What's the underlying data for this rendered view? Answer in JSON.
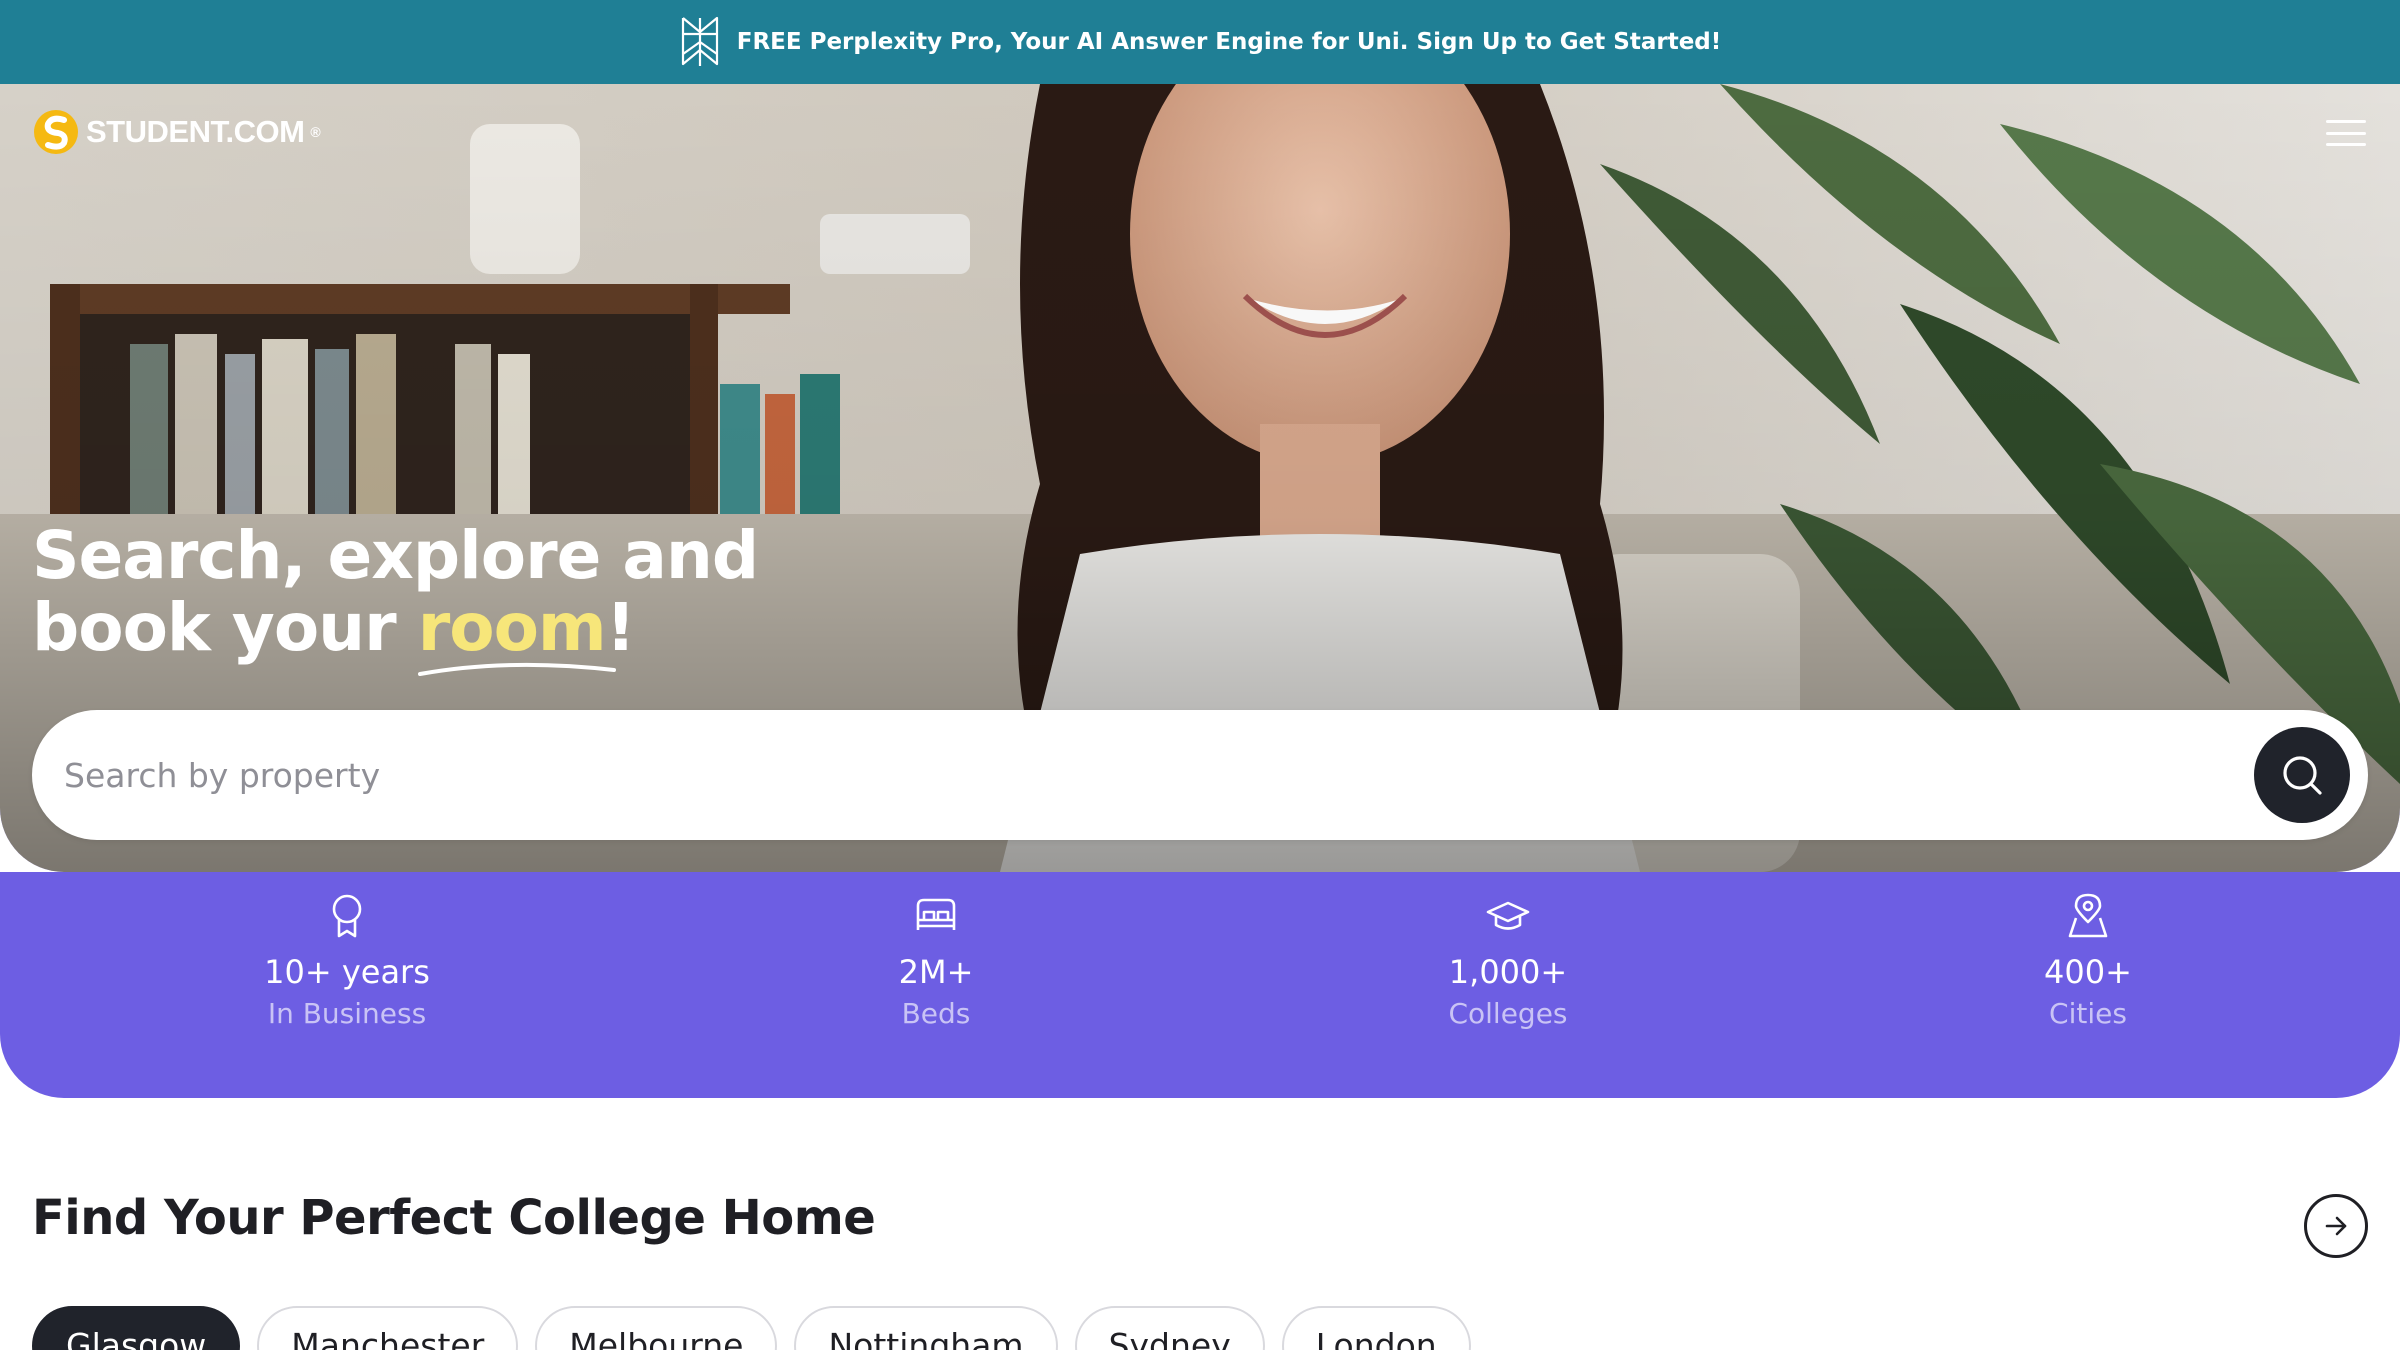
{
  "promo": {
    "text": "FREE Perplexity Pro, Your AI Answer Engine for Uni. Sign Up to Get Started!",
    "icon": "perplexity-icon",
    "background": "#1f7f95"
  },
  "header": {
    "logo_text": "STUDENT.COM",
    "logo_mark": "®",
    "menu_icon": "hamburger-icon"
  },
  "hero": {
    "headline_line1": "Search, explore and",
    "headline_line2_prefix": "book your ",
    "headline_accent": "room",
    "headline_suffix": "!",
    "accent_color": "#f7e67a"
  },
  "search": {
    "placeholder": "Search by property",
    "value": "",
    "icon": "search-icon"
  },
  "stats": [
    {
      "icon": "award-icon",
      "value": "10+ years",
      "label": "In Business"
    },
    {
      "icon": "bed-icon",
      "value": "2M+",
      "label": "Beds"
    },
    {
      "icon": "graduation-cap-icon",
      "value": "1,000+",
      "label": "Colleges"
    },
    {
      "icon": "location-pin-icon",
      "value": "400+",
      "label": "Cities"
    }
  ],
  "stats_background": "#6d5ee3",
  "section": {
    "title": "Find Your Perfect College Home",
    "arrow_icon": "arrow-right-icon"
  },
  "cities": [
    "Glasgow",
    "Manchester",
    "Melbourne",
    "Nottingham",
    "Sydney",
    "London"
  ],
  "active_city": "Glasgow"
}
